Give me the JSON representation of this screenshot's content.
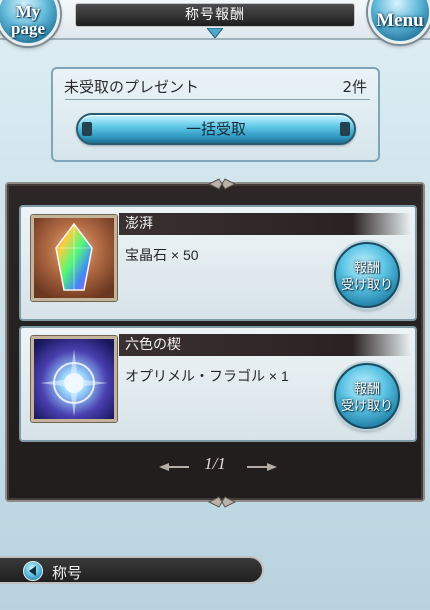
{
  "header": {
    "mypage_line1": "My",
    "mypage_line2": "page",
    "title": "称号報酬",
    "menu_label": "Menu"
  },
  "present": {
    "label": "未受取のプレゼント",
    "count": "2件",
    "bulk_button_label": "一括受取"
  },
  "rewards": [
    {
      "name": "澎湃",
      "description": "宝晶石 × 50",
      "button_line1": "報酬",
      "button_line2": "受け取り",
      "icon": "rainbow-crystal-icon"
    },
    {
      "name": "六色の楔",
      "description": "オプリメル・フラゴル × 1",
      "button_line1": "報酬",
      "button_line2": "受け取り",
      "icon": "prism-burst-icon"
    }
  ],
  "pagination": {
    "label": "1/1"
  },
  "bottom_nav": {
    "back_label": "称号",
    "icon": "back-arrow-icon"
  },
  "colors": {
    "accent_blue": "#5fb7d8",
    "dark_panel": "#2c2626",
    "background": "#cfe4ec"
  }
}
